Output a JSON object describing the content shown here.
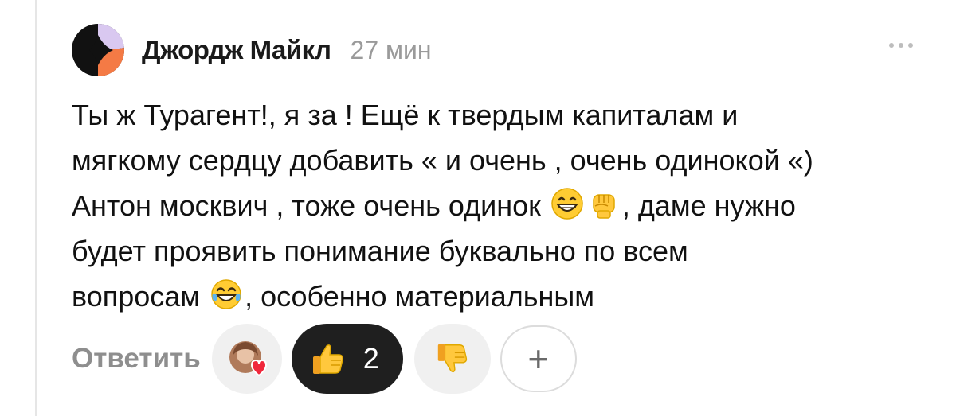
{
  "comment": {
    "author": "Джордж Майкл",
    "time": "27 мин",
    "text_lines": [
      "Ты ж Турагент!, я за ! Ещё к твердым капиталам и",
      "мягкому сердцу добавить « и очень , очень одинокой «)",
      "Антон москвич , тоже очень одинок",
      ", даме нужно",
      "будет проявить понимание буквально по всем",
      "вопросам",
      ", особенно материальным"
    ],
    "emojis": [
      "grinning-face-icon",
      "raised-fist-icon",
      "tears-of-joy-icon"
    ]
  },
  "actions": {
    "reply_label": "Ответить",
    "like_count": "2",
    "add_label": "+"
  },
  "colors": {
    "background": "#ffffff",
    "like_pill": "#1f1f1f",
    "chip_gray": "#f0f0f0",
    "muted_text": "#9a9a9a",
    "avatar_purple": "#d9c8f0",
    "avatar_orange": "#f47a45",
    "avatar_black": "#111111"
  }
}
